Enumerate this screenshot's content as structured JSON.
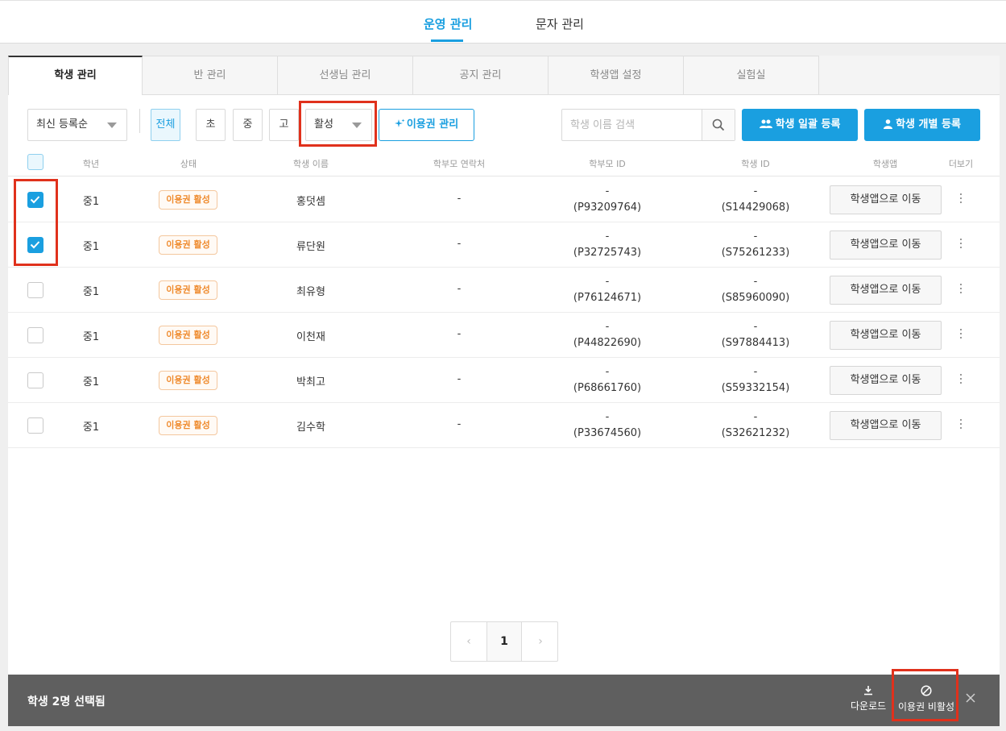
{
  "top_nav": {
    "tabs": [
      {
        "label": "운영 관리",
        "active": true
      },
      {
        "label": "문자 관리",
        "active": false
      }
    ]
  },
  "sub_tabs": [
    {
      "label": "학생 관리",
      "active": true
    },
    {
      "label": "반 관리",
      "active": false
    },
    {
      "label": "선생님 관리",
      "active": false
    },
    {
      "label": "공지 관리",
      "active": false
    },
    {
      "label": "학생앱 설정",
      "active": false
    },
    {
      "label": "실험실",
      "active": false
    }
  ],
  "toolbar": {
    "sort_select": "최신 등록순",
    "grade_chips": [
      "전체",
      "초",
      "중",
      "고"
    ],
    "active_grade": "전체",
    "status_select": "활성",
    "ticket_manage_label": "이용권 관리",
    "search_placeholder": "학생 이름 검색",
    "bulk_register_label": "학생 일괄 등록",
    "single_register_label": "학생 개별 등록"
  },
  "table": {
    "columns": [
      "학년",
      "상태",
      "학생 이름",
      "학부모 연락처",
      "학부모 ID",
      "학생 ID",
      "학생앱",
      "더보기"
    ],
    "status_badge": "이용권 활성",
    "app_button_label": "학생앱으로 이동",
    "rows": [
      {
        "checked": true,
        "grade": "중1",
        "name": "홍덧셈",
        "parent_contact": "-",
        "parent_id_top": "-",
        "parent_id": "(P93209764)",
        "student_id_top": "-",
        "student_id": "(S14429068)"
      },
      {
        "checked": true,
        "grade": "중1",
        "name": "류단원",
        "parent_contact": "-",
        "parent_id_top": "-",
        "parent_id": "(P32725743)",
        "student_id_top": "-",
        "student_id": "(S75261233)"
      },
      {
        "checked": false,
        "grade": "중1",
        "name": "최유형",
        "parent_contact": "-",
        "parent_id_top": "-",
        "parent_id": "(P76124671)",
        "student_id_top": "-",
        "student_id": "(S85960090)"
      },
      {
        "checked": false,
        "grade": "중1",
        "name": "이천재",
        "parent_contact": "-",
        "parent_id_top": "-",
        "parent_id": "(P44822690)",
        "student_id_top": "-",
        "student_id": "(S97884413)"
      },
      {
        "checked": false,
        "grade": "중1",
        "name": "박최고",
        "parent_contact": "-",
        "parent_id_top": "-",
        "parent_id": "(P68661760)",
        "student_id_top": "-",
        "student_id": "(S59332154)"
      },
      {
        "checked": false,
        "grade": "중1",
        "name": "김수학",
        "parent_contact": "-",
        "parent_id_top": "-",
        "parent_id": "(P33674560)",
        "student_id_top": "-",
        "student_id": "(S32621232)"
      }
    ]
  },
  "pagination": {
    "prev": "‹",
    "current": "1",
    "next": "›"
  },
  "bottom_bar": {
    "selection_text": "학생 2명 선택됨",
    "download_label": "다운로드",
    "deactivate_label": "이용권 비활성",
    "close": "✕"
  },
  "colors": {
    "accent": "#1a9fe0",
    "badge": "#ef8a2c",
    "highlight": "#e0311c",
    "bottom_bar": "#5f5f5f"
  }
}
